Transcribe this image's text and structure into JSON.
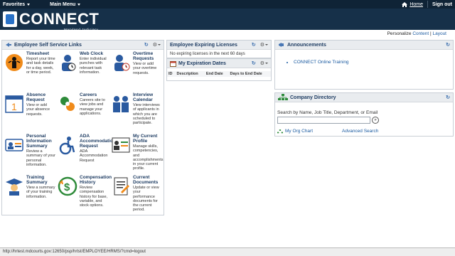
{
  "topbar": {
    "favorites": "Favorites",
    "main_menu": "Main Menu",
    "home": "Home",
    "signout": "Sign out"
  },
  "header": {
    "brand": "CONNECT",
    "subtitle": "Maryland Judiciary"
  },
  "personalize": {
    "prefix": "Personalize",
    "content": "Content",
    "sep": "|",
    "layout": "Layout"
  },
  "ess": {
    "title": "Employee Self Service Links",
    "tiles": [
      {
        "title": "Timesheet",
        "desc": "Report your time and task details for a day, week, or time period."
      },
      {
        "title": "Web Clock",
        "desc": "Enter individual punches with relevant task information."
      },
      {
        "title": "Overtime Requests",
        "desc": "View or add your overtime requests."
      },
      {
        "title": "Absence Request",
        "desc": "View or add your absence requests."
      },
      {
        "title": "Careers",
        "desc": "Careers site to view jobs and manage your applications."
      },
      {
        "title": "Interview Calendar",
        "desc": "View interviews of applicants in which you are scheduled to participate."
      },
      {
        "title": "Personal Information Summary",
        "desc": "Review a summary of your personal information."
      },
      {
        "title": "ADA Accommodation Request",
        "desc": "ADA Accommodation Request"
      },
      {
        "title": "My Current Profile",
        "desc": "Manage skills, competencies, and accomplishments in your current profile."
      },
      {
        "title": "Training Summary",
        "desc": "View a summary of your training information."
      },
      {
        "title": "Compensation History",
        "desc": "Review compensation history for base, variable, and stock options."
      },
      {
        "title": "Current Documents",
        "desc": "Update or view your performance documents for the current period."
      }
    ]
  },
  "expiring": {
    "title": "Employee Expiring Licenses",
    "message": "No expiring licenses in the next 60 days"
  },
  "myexp": {
    "title": "My Expiration Dates",
    "columns": [
      "ID",
      "Description",
      "End Date",
      "Days to End Date"
    ]
  },
  "announcements": {
    "title": "Announcements",
    "items": [
      "CONNECT Online Training"
    ]
  },
  "directory": {
    "title": "Company Directory",
    "label": "Search by Name, Job Title, Department, or Email",
    "org_chart": "My Org Chart",
    "advanced": "Advanced Search"
  },
  "status": {
    "url": "http://hrtest.mdcourts.gov:12650/psp/hrtst/EMPLOYEE/HRMS/?cmd=logout"
  },
  "colors": {
    "topbar": "#0f2336",
    "header": "#163049",
    "link": "#1a5aa0",
    "panel_title": "#1f3d63"
  }
}
